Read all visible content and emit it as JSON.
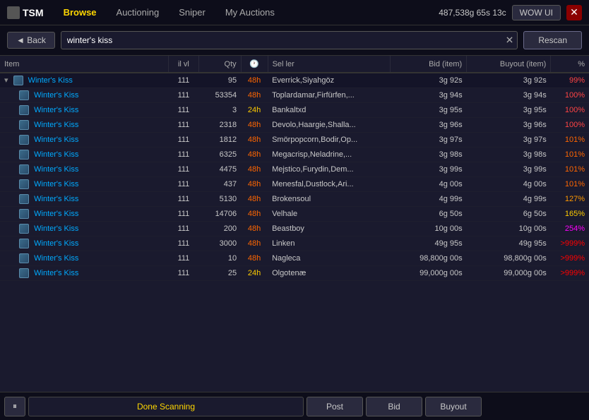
{
  "titlebar": {
    "logo": "TSM",
    "nav": [
      {
        "id": "browse",
        "label": "Browse",
        "active": true
      },
      {
        "id": "auctioning",
        "label": "Auctioning",
        "active": false
      },
      {
        "id": "sniper",
        "label": "Sniper",
        "active": false
      },
      {
        "id": "my-auctions",
        "label": "My Auctions",
        "active": false
      }
    ],
    "gold": "487,538g 65s 13c",
    "wow_ui": "WOW UI",
    "close": "✕"
  },
  "searchbar": {
    "back_label": "◄ Back",
    "search_value": "winter's kiss",
    "clear_label": "✕",
    "rescan_label": "Rescan"
  },
  "table": {
    "columns": [
      {
        "id": "item",
        "label": "Item"
      },
      {
        "id": "ilvl",
        "label": "il vl"
      },
      {
        "id": "qty",
        "label": "Qty"
      },
      {
        "id": "time",
        "label": "🕐"
      },
      {
        "id": "seller",
        "label": "Sel ler"
      },
      {
        "id": "bid",
        "label": "Bid (item)"
      },
      {
        "id": "buyout",
        "label": "Buyout (item)"
      },
      {
        "id": "pct",
        "label": "%"
      }
    ],
    "rows": [
      {
        "group": true,
        "name": "Winter's Kiss",
        "ilvl": "111",
        "qty": "95",
        "time": "48h",
        "seller": "Everrick,Siyahgöz",
        "bid": "3g 92s",
        "buyout": "3g 92s",
        "pct": "99%",
        "pct_class": "pct-99"
      },
      {
        "group": false,
        "name": "Winter's Kiss",
        "ilvl": "111",
        "qty": "53354",
        "time": "48h",
        "seller": "Toplardamar,Firfürfen,...",
        "bid": "3g 94s",
        "buyout": "3g 94s",
        "pct": "100%",
        "pct_class": "pct-100"
      },
      {
        "group": false,
        "name": "Winter's Kiss",
        "ilvl": "111",
        "qty": "3",
        "time": "24h",
        "seller": "Bankaltxd",
        "bid": "3g 95s",
        "buyout": "3g 95s",
        "pct": "100%",
        "pct_class": "pct-100"
      },
      {
        "group": false,
        "name": "Winter's Kiss",
        "ilvl": "111",
        "qty": "2318",
        "time": "48h",
        "seller": "Devolo,Haargie,Shalla...",
        "bid": "3g 96s",
        "buyout": "3g 96s",
        "pct": "100%",
        "pct_class": "pct-100"
      },
      {
        "group": false,
        "name": "Winter's Kiss",
        "ilvl": "111",
        "qty": "1812",
        "time": "48h",
        "seller": "Smörpopcorn,Bodir,Op...",
        "bid": "3g 97s",
        "buyout": "3g 97s",
        "pct": "101%",
        "pct_class": "pct-101"
      },
      {
        "group": false,
        "name": "Winter's Kiss",
        "ilvl": "111",
        "qty": "6325",
        "time": "48h",
        "seller": "Megacrisp,Neladrine,...",
        "bid": "3g 98s",
        "buyout": "3g 98s",
        "pct": "101%",
        "pct_class": "pct-101"
      },
      {
        "group": false,
        "name": "Winter's Kiss",
        "ilvl": "111",
        "qty": "4475",
        "time": "48h",
        "seller": "Mejstico,Furydin,Dem...",
        "bid": "3g 99s",
        "buyout": "3g 99s",
        "pct": "101%",
        "pct_class": "pct-101"
      },
      {
        "group": false,
        "name": "Winter's Kiss",
        "ilvl": "111",
        "qty": "437",
        "time": "48h",
        "seller": "Menesfal,Dustlock,Ari...",
        "bid": "4g 00s",
        "buyout": "4g 00s",
        "pct": "101%",
        "pct_class": "pct-101"
      },
      {
        "group": false,
        "name": "Winter's Kiss",
        "ilvl": "111",
        "qty": "5130",
        "time": "48h",
        "seller": "Brokensoul",
        "bid": "4g 99s",
        "buyout": "4g 99s",
        "pct": "127%",
        "pct_class": "pct-127"
      },
      {
        "group": false,
        "name": "Winter's Kiss",
        "ilvl": "111",
        "qty": "14706",
        "time": "48h",
        "seller": "Velhale",
        "bid": "6g 50s",
        "buyout": "6g 50s",
        "pct": "165%",
        "pct_class": "pct-165"
      },
      {
        "group": false,
        "name": "Winter's Kiss",
        "ilvl": "111",
        "qty": "200",
        "time": "48h",
        "seller": "Beastboy",
        "bid": "10g 00s",
        "buyout": "10g 00s",
        "pct": "254%",
        "pct_class": "pct-254"
      },
      {
        "group": false,
        "name": "Winter's Kiss",
        "ilvl": "111",
        "qty": "3000",
        "time": "48h",
        "seller": "Linken",
        "bid": "49g 95s",
        "buyout": "49g 95s",
        "pct": ">999%",
        "pct_class": "pct-999"
      },
      {
        "group": false,
        "name": "Winter's Kiss",
        "ilvl": "111",
        "qty": "10",
        "time": "48h",
        "seller": "Nagleca",
        "bid": "98,800g 00s",
        "buyout": "98,800g 00s",
        "pct": ">999%",
        "pct_class": "pct-999"
      },
      {
        "group": false,
        "name": "Winter's Kiss",
        "ilvl": "111",
        "qty": "25",
        "time": "24h",
        "seller": "Olgotenæ",
        "bid": "99,000g 00s",
        "buyout": "99,000g 00s",
        "pct": ">999%",
        "pct_class": "pct-999"
      }
    ]
  },
  "statusbar": {
    "pause_label": "⏸",
    "status_text": "Done Scanning",
    "post_label": "Post",
    "bid_label": "Bid",
    "buyout_label": "Buyout"
  }
}
